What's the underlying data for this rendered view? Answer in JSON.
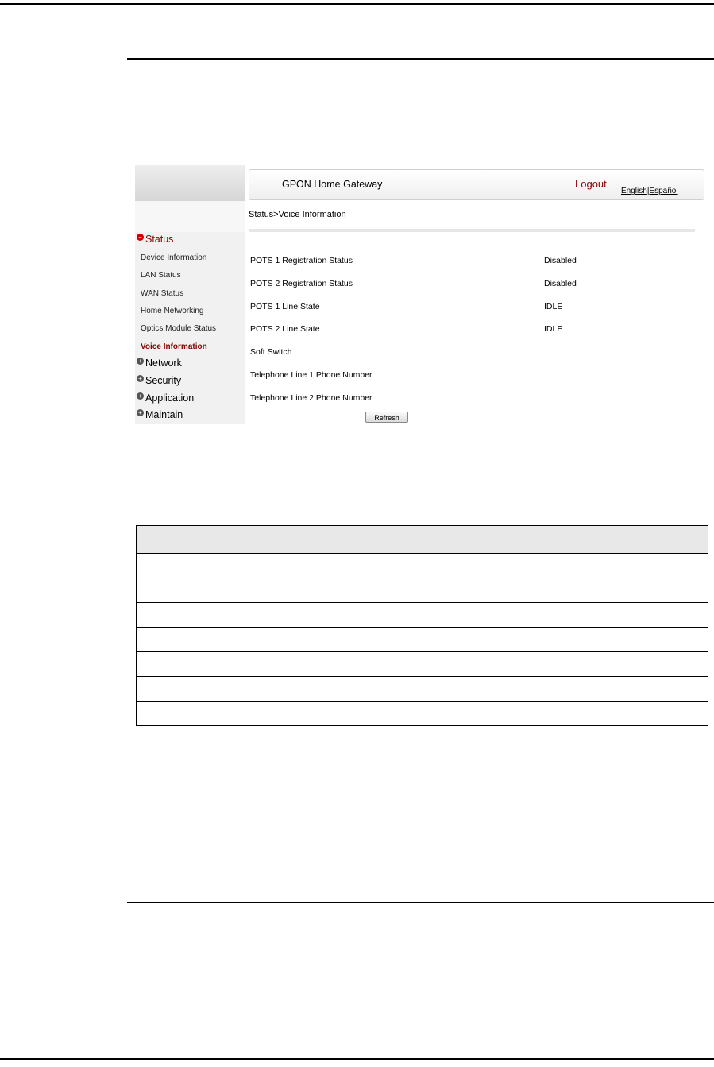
{
  "app": {
    "title": "GPON Home Gateway",
    "logout_label": "Logout",
    "lang_english": "English",
    "lang_sep": "|",
    "lang_espanol": "Español"
  },
  "breadcrumb": "Status>Voice Information",
  "sidebar": {
    "status_label": "Status",
    "items": [
      {
        "label": "Device Information"
      },
      {
        "label": "LAN Status"
      },
      {
        "label": "WAN Status"
      },
      {
        "label": "Home Networking"
      },
      {
        "label": "Optics Module Status"
      },
      {
        "label": "Voice Information",
        "active": true
      }
    ],
    "sections": [
      {
        "label": "Network"
      },
      {
        "label": "Security"
      },
      {
        "label": "Application"
      },
      {
        "label": "Maintain"
      }
    ]
  },
  "voice_info": {
    "rows": [
      {
        "label": "POTS 1 Registration Status",
        "value": "Disabled"
      },
      {
        "label": "POTS 2 Registration Status",
        "value": "Disabled"
      },
      {
        "label": "POTS 1 Line State",
        "value": "IDLE"
      },
      {
        "label": "POTS 2 Line State",
        "value": "IDLE"
      },
      {
        "label": "Soft Switch",
        "value": ""
      },
      {
        "label": "Telephone Line 1 Phone Number",
        "value": ""
      },
      {
        "label": "Telephone Line 2 Phone Number",
        "value": ""
      }
    ],
    "refresh_label": "Refresh"
  },
  "colors": {
    "accent": "#8b0000",
    "sidebar_bg": "#f1f1f1"
  }
}
